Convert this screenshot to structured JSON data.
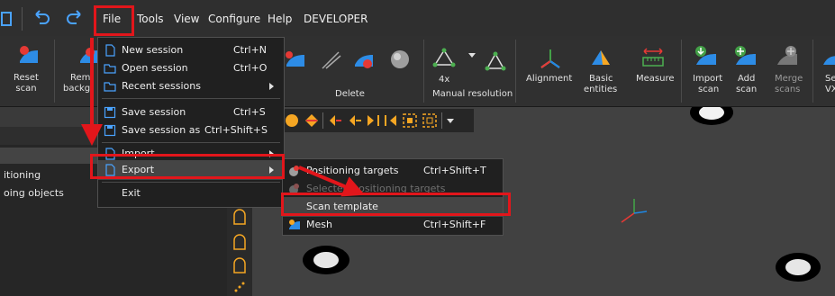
{
  "menubar": {
    "items": [
      "File",
      "Tools",
      "View",
      "Configure",
      "Help",
      "DEVELOPER"
    ]
  },
  "ribbon": {
    "reset_scan": [
      "Reset",
      "scan"
    ],
    "remove_bg": [
      "Rem",
      "backg"
    ],
    "delete_group": "Delete",
    "resolution_value": "4x",
    "manual_resolution": "Manual resolution",
    "alignment": "Alignment",
    "basic_entities": [
      "Basic",
      "entities"
    ],
    "measure": "Measure",
    "import_scan": [
      "Import",
      "scan"
    ],
    "add_scan": [
      "Add",
      "scan"
    ],
    "merge_scans": [
      "Merge",
      "scans"
    ],
    "cut_right": [
      "Se",
      "VX"
    ]
  },
  "left_panel": {
    "row1": "itioning",
    "row2": "oing objects"
  },
  "file_menu": {
    "items": [
      {
        "label": "New session",
        "shortcut": "Ctrl+N"
      },
      {
        "label": "Open session",
        "shortcut": "Ctrl+O"
      },
      {
        "label": "Recent sessions",
        "shortcut": ""
      },
      {
        "label": "Save session",
        "shortcut": "Ctrl+S"
      },
      {
        "label": "Save session as",
        "shortcut": "Ctrl+Shift+S"
      },
      {
        "label": "Import",
        "shortcut": ""
      },
      {
        "label": "Export",
        "shortcut": ""
      },
      {
        "label": "Exit",
        "shortcut": ""
      }
    ]
  },
  "export_menu": {
    "items": [
      {
        "label": "Positioning targets",
        "shortcut": "Ctrl+Shift+T"
      },
      {
        "label": "Selected positioning targets",
        "shortcut": ""
      },
      {
        "label": "Scan template",
        "shortcut": ""
      },
      {
        "label": "Mesh",
        "shortcut": "Ctrl+Shift+F"
      }
    ]
  },
  "colors": {
    "highlight_red": "#e2161b",
    "accent_blue": "#1e88e5",
    "accent_orange": "#f5a623"
  }
}
